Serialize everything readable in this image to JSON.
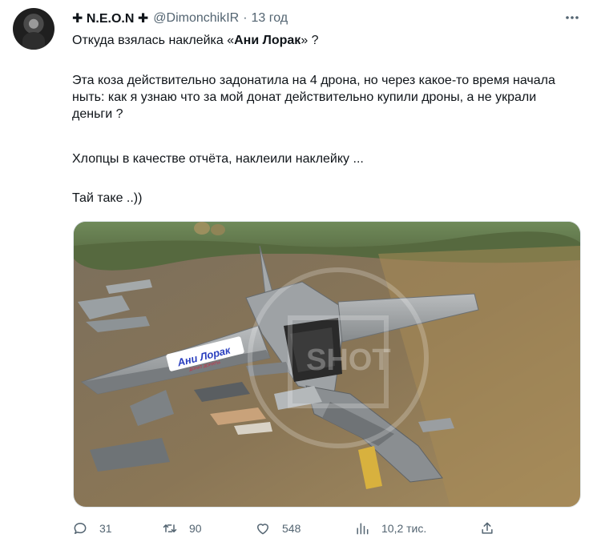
{
  "tweet": {
    "name": "✚ N.E.O.N ✚",
    "handle": "@DimonchikIR",
    "separator": "·",
    "time": "13 год",
    "text": {
      "line1_pre": "Откуда взялась наклейка «",
      "line1_bold": "Ани Лорак",
      "line1_post": "» ?",
      "paragraph2": "Эта коза действительно задонатила на 4 дрона, но через какое-то время начала ныть: как я узнаю что за мой донат действительно купили дроны, а не украли деньги ?",
      "paragraph3": "Хлопцы в качестве отчёта, наклеили наклейку ...",
      "paragraph4": "Тай таке ..))"
    },
    "media": {
      "sticker_text": "Ани Лорак",
      "sticker_subtext": "ДОНАТ ДОНАТЫ",
      "watermark_text": "SHOT"
    },
    "actions": {
      "replies": "31",
      "retweets": "90",
      "likes": "548",
      "views": "10,2 тис."
    }
  }
}
